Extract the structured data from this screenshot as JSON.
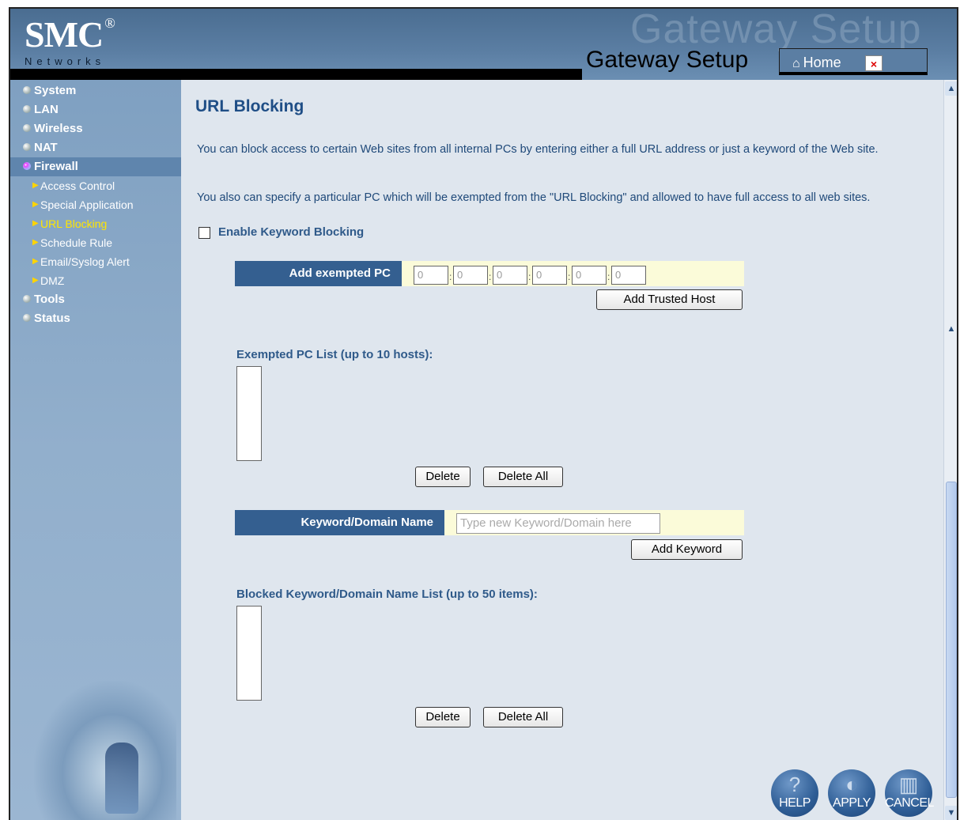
{
  "header": {
    "logo": "SMC",
    "logo_mark": "®",
    "logo_sub": "Networks",
    "bg_title": "Gateway Setup",
    "title": "Gateway Setup",
    "home_label": "Home",
    "home_icon": "home-icon",
    "close_icon": "close-icon"
  },
  "sidebar": {
    "items": [
      {
        "label": "System"
      },
      {
        "label": "LAN"
      },
      {
        "label": "Wireless"
      },
      {
        "label": "NAT"
      },
      {
        "label": "Firewall"
      },
      {
        "label": "Tools"
      },
      {
        "label": "Status"
      }
    ],
    "firewall_sub": [
      {
        "label": "Access Control"
      },
      {
        "label": "Special Application"
      },
      {
        "label": "URL Blocking"
      },
      {
        "label": "Schedule Rule"
      },
      {
        "label": "Email/Syslog Alert"
      },
      {
        "label": "DMZ"
      }
    ],
    "current": "URL Blocking"
  },
  "main": {
    "title": "URL Blocking",
    "desc1": "You can block access to certain Web sites from all internal PCs by entering either a full URL address or just a keyword of the Web site.",
    "desc2": "You also can specify a particular PC which will be exempted from the \"URL Blocking\" and allowed to have full access to all web sites.",
    "enable_keyword_label": "Enable Keyword Blocking",
    "enable_keyword_checked": false,
    "exempt": {
      "label": "Add exempted PC",
      "ip_values": [
        "0",
        "0",
        "0",
        "0",
        "0",
        "0"
      ],
      "separator": ":",
      "add_button": "Add Trusted Host"
    },
    "exempt_list": {
      "title": "Exempted PC List (up to 10 hosts):",
      "delete": "Delete",
      "delete_all": "Delete All"
    },
    "keyword": {
      "label": "Keyword/Domain Name",
      "placeholder": "Type new Keyword/Domain here",
      "add_button": "Add Keyword"
    },
    "blocked_list": {
      "title": "Blocked Keyword/Domain Name List (up to 50 items):",
      "delete": "Delete",
      "delete_all": "Delete All"
    }
  },
  "footer_buttons": {
    "help": "HELP",
    "apply": "APPLY",
    "cancel": "CANCEL"
  },
  "colors": {
    "accent": "#345f90",
    "title": "#1f4e86",
    "highlight": "#ffe600",
    "field_band": "#fbfbd9"
  }
}
